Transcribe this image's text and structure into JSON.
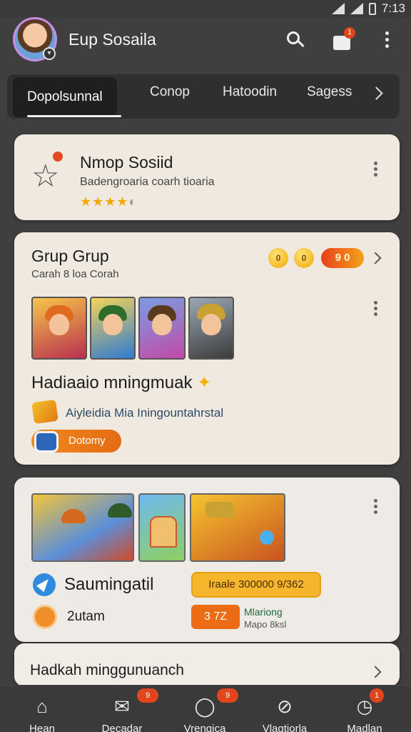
{
  "status_bar": {
    "time": "7:13"
  },
  "app": {
    "title": "Eup Sosaila"
  },
  "header": {
    "notification_count": "1"
  },
  "tabs": [
    {
      "label": "Dopolsunnal"
    },
    {
      "label": "Conop"
    },
    {
      "label": "Hatoodin"
    },
    {
      "label": "Sagess"
    }
  ],
  "card1": {
    "title": "Nmop Sosiid",
    "subtitle": "Badengroaria coarh tioaria",
    "rating_stars": "★★★★",
    "rating_value": 4.5
  },
  "card2": {
    "title": "Grup Grup",
    "subtitle": "Carah 8 loa Corah",
    "coin1": "0",
    "coin2": "0",
    "pill": "9 0",
    "heading": "Hadiaaio mningmuak",
    "note": "Aiyleidia Mia Iningountahrstal",
    "button_label": "Dotomy"
  },
  "card3": {
    "title": "Saumingatil",
    "prize_pill": "Iraale 300000 9/362",
    "user": "2utam",
    "badge": "3 7Z",
    "meta_line1": "Mlariong",
    "meta_line2": "Mapo 8ksl"
  },
  "card4": {
    "title": "Hadkah minggunuanch"
  },
  "bottom_nav": [
    {
      "label": "Hean",
      "icon": "home-icon",
      "badge": ""
    },
    {
      "label": "Decadar",
      "icon": "mail-icon",
      "badge": "9"
    },
    {
      "label": "Vrengica",
      "icon": "chat-icon",
      "badge": "9"
    },
    {
      "label": "Vlagtiorla",
      "icon": "compass-icon",
      "badge": ""
    },
    {
      "label": "Madlan",
      "icon": "clock-icon",
      "badge": "1"
    }
  ],
  "colors": {
    "accent": "#e56b13",
    "badge": "#e2451b",
    "gold": "#f5b62e"
  }
}
